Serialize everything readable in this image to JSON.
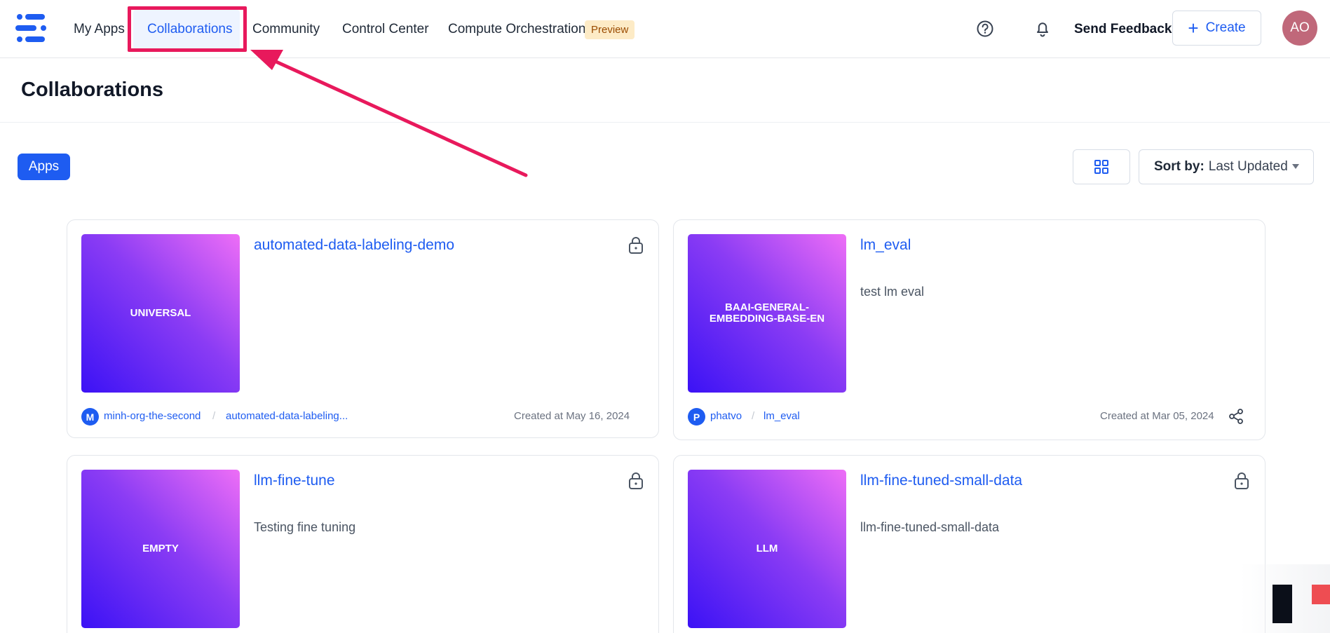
{
  "nav": {
    "items": [
      {
        "label": "My Apps"
      },
      {
        "label": "Collaborations"
      },
      {
        "label": "Community"
      },
      {
        "label": "Control Center"
      },
      {
        "label": "Compute Orchestration"
      }
    ],
    "preview_badge": "Preview",
    "help_icon": "help-circle-icon",
    "bell_icon": "bell-icon",
    "feedback_label": "Send Feedback",
    "create_label": "Create",
    "avatar_initials": "AO",
    "accent_color": "#1e5cf1"
  },
  "page": {
    "title": "Collaborations",
    "filter_pill": "Apps",
    "sort_label": "Sort by:",
    "sort_value": "Last Updated"
  },
  "cards": [
    {
      "thumb_label": "UNIVERSAL",
      "title": "automated-data-labeling-demo",
      "description": "",
      "locked": true,
      "org_initial": "M",
      "org": "minh-org-the-second",
      "app": "automated-data-labeling...",
      "created": "Created at May 16, 2024",
      "shareable": false
    },
    {
      "thumb_label": "BAAI-GENERAL-EMBEDDING-BASE-EN",
      "title": "lm_eval",
      "description": "test lm eval",
      "locked": false,
      "org_initial": "P",
      "org": "phatvo",
      "app": "lm_eval",
      "created": "Created at Mar 05, 2024",
      "shareable": true
    },
    {
      "thumb_label": "EMPTY",
      "title": "llm-fine-tune",
      "description": "Testing fine tuning",
      "locked": true
    },
    {
      "thumb_label": "LLM",
      "title": "llm-fine-tuned-small-data",
      "description": "llm-fine-tuned-small-data",
      "locked": true
    }
  ]
}
